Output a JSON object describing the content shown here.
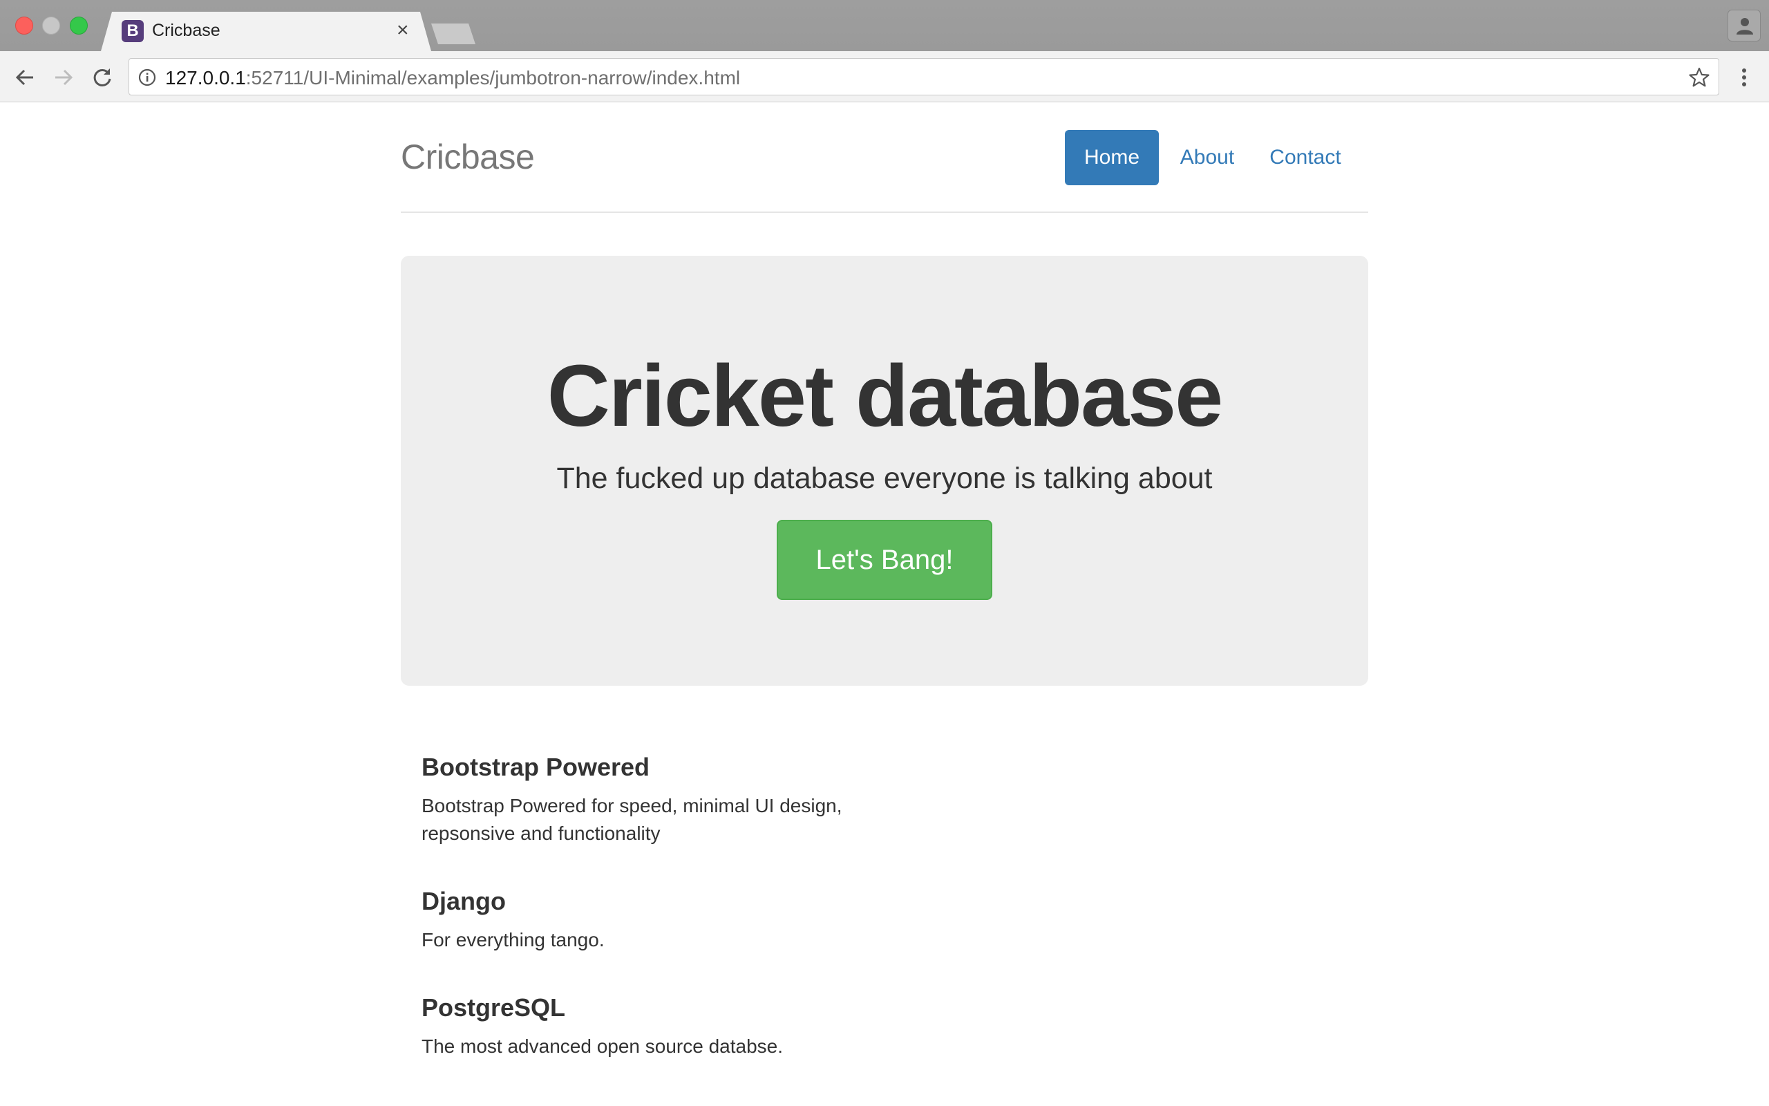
{
  "browser": {
    "tab_title": "Cricbase",
    "tab_favicon_letter": "B",
    "tab_close": "×",
    "url_host": "127.0.0.1",
    "url_rest": ":52711/UI-Minimal/examples/jumbotron-narrow/index.html"
  },
  "header": {
    "brand": "Cricbase",
    "nav": [
      {
        "label": "Home",
        "active": true
      },
      {
        "label": "About",
        "active": false
      },
      {
        "label": "Contact",
        "active": false
      }
    ]
  },
  "jumbotron": {
    "title": "Cricket database",
    "lead": "The fucked up database everyone is talking about",
    "button_label": "Let's Bang!"
  },
  "features": [
    {
      "heading": "Bootstrap Powered",
      "text": "Bootstrap Powered for speed, minimal UI design, repsonsive and functionality"
    },
    {
      "heading": "Django",
      "text": "For everything tango."
    },
    {
      "heading": "PostgreSQL",
      "text": "The most advanced open source databse."
    }
  ],
  "colors": {
    "primary": "#337ab7",
    "success": "#5cb85c",
    "jumbotron_bg": "#eeeeee",
    "brand_text": "#777777"
  }
}
